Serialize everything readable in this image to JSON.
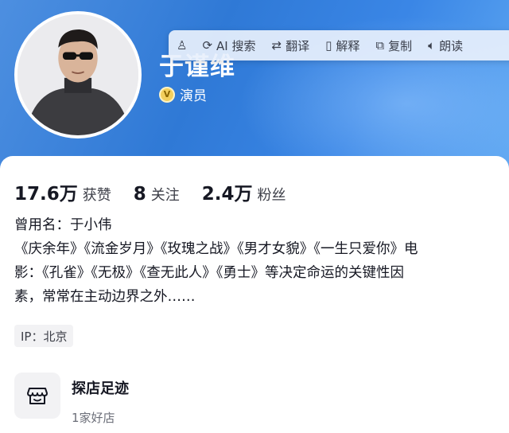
{
  "profile": {
    "name": "于谨维",
    "verify_badge": "V",
    "verified_title": "演员"
  },
  "ai_toolbar": {
    "items": [
      {
        "icon": "refresh-sparkle-icon",
        "label": "AI 搜索"
      },
      {
        "icon": "translate-icon",
        "label": "翻译"
      },
      {
        "icon": "book-icon",
        "label": "解释"
      },
      {
        "icon": "copy-icon",
        "label": "复制"
      },
      {
        "icon": "speaker-icon",
        "label": "朗读"
      }
    ]
  },
  "stats": [
    {
      "value": "17.6万",
      "label": "获赞"
    },
    {
      "value": "8",
      "label": "关注"
    },
    {
      "value": "2.4万",
      "label": "粉丝"
    }
  ],
  "bio": {
    "lines": [
      "曾用名：于小伟",
      "《庆余年》《流金岁月》《玫瑰之战》《男才女貌》《一生只爱你》电",
      "影：《孔雀》《无极》《查无此人》《勇士》等决定命运的关键性因",
      "素，常常在主动边界之外……"
    ]
  },
  "ip": "IP：北京",
  "footprint": {
    "title": "探店足迹",
    "subtitle": "1家好店",
    "icon": "shop-icon"
  },
  "colors": {
    "header_blue": "#2f79d6",
    "verify_gold": "#f3cf5d",
    "text_primary": "#161823",
    "text_secondary": "#6b6e78"
  }
}
